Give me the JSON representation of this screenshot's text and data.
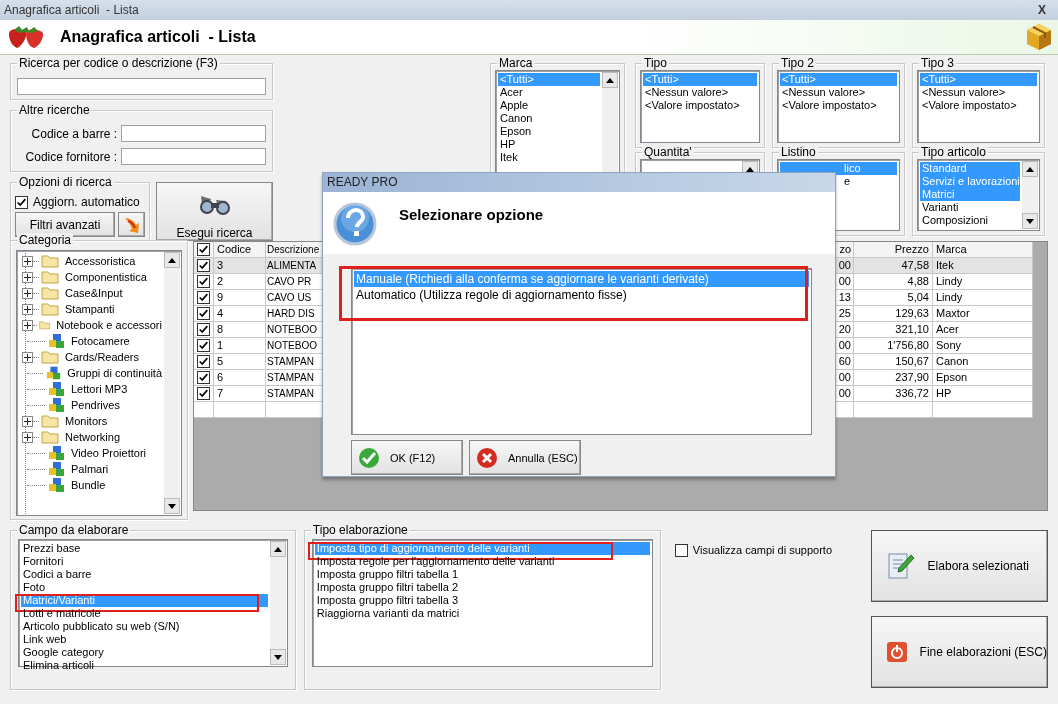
{
  "window": {
    "title": "Anagrafica articoli  - Lista",
    "close": "X"
  },
  "header": {
    "title": "Anagrafica articoli  - Lista"
  },
  "search": {
    "label": "Ricerca per codice o descrizione (F3)"
  },
  "other_searches": {
    "label": "Altre ricerche",
    "fields": [
      {
        "label": "Codice a barre :"
      },
      {
        "label": "Codice fornitore :"
      }
    ]
  },
  "search_options": {
    "label": "Opzioni di ricerca",
    "auto_update": {
      "label": "Aggiorn. automatico",
      "checked": true
    },
    "advanced_filters": "Filtri avanzati"
  },
  "run_search": "Esegui ricerca",
  "filters": [
    {
      "label": "Marca",
      "items": [
        {
          "text": "<Tutti>",
          "selected": true
        },
        {
          "text": "Acer",
          "selected": false
        },
        {
          "text": "Apple",
          "selected": false
        },
        {
          "text": "Canon",
          "selected": false
        },
        {
          "text": "Epson",
          "selected": false
        },
        {
          "text": "HP",
          "selected": false
        },
        {
          "text": "Itek",
          "selected": false
        }
      ]
    },
    {
      "label": "Tipo",
      "items": [
        {
          "text": "<Tutti>",
          "selected": true
        },
        {
          "text": "<Nessun valore>",
          "selected": false
        },
        {
          "text": "<Valore impostato>",
          "selected": false
        }
      ]
    },
    {
      "label": "Tipo 2",
      "items": [
        {
          "text": "<Tutti>",
          "selected": true
        },
        {
          "text": "<Nessun valore>",
          "selected": false
        },
        {
          "text": "<Valore impostato>",
          "selected": false
        }
      ]
    },
    {
      "label": "Tipo 3",
      "items": [
        {
          "text": "<Tutti>",
          "selected": true
        },
        {
          "text": "<Nessun valore>",
          "selected": false
        },
        {
          "text": "<Valore impostato>",
          "selected": false
        }
      ]
    },
    {
      "label": "Quantita'"
    },
    {
      "label": "Listino",
      "items": [
        {
          "text": "lico",
          "selected": true
        },
        {
          "text": "e",
          "selected": false
        }
      ]
    },
    {
      "label": "Tipo articolo",
      "items": [
        {
          "text": "Standard",
          "selected": true
        },
        {
          "text": "Servizi e lavorazioni",
          "selected": true
        },
        {
          "text": "Matrici",
          "selected": true
        },
        {
          "text": "Varianti",
          "selected": false
        },
        {
          "text": "Composizioni",
          "selected": false
        }
      ]
    }
  ],
  "category": {
    "label": "Categoria",
    "items": [
      {
        "text": "Accessoristica",
        "kind": "folder"
      },
      {
        "text": "Componentistica",
        "kind": "folder"
      },
      {
        "text": "Case&Input",
        "kind": "folder"
      },
      {
        "text": "Stampanti",
        "kind": "folder"
      },
      {
        "text": "Notebook e accessori",
        "kind": "folder"
      },
      {
        "text": "Fotocamere",
        "kind": "group"
      },
      {
        "text": "Cards/Readers",
        "kind": "folder"
      },
      {
        "text": "Gruppi di continuità",
        "kind": "group"
      },
      {
        "text": "Lettori MP3",
        "kind": "group"
      },
      {
        "text": "Pendrives",
        "kind": "group"
      },
      {
        "text": "Monitors",
        "kind": "folder"
      },
      {
        "text": "Networking",
        "kind": "folder"
      },
      {
        "text": "Video Proiettori",
        "kind": "group"
      },
      {
        "text": "Palmari",
        "kind": "group"
      },
      {
        "text": "Bundle",
        "kind": "group"
      }
    ]
  },
  "table": {
    "all_checked": true,
    "columns": [
      "Codice",
      "Descrizione",
      "zo",
      "Prezzo",
      "Marca"
    ],
    "rows": [
      {
        "checked": true,
        "selected": true,
        "cells": [
          "3",
          "ALIMENTA",
          "00",
          "47,58",
          "Itek"
        ]
      },
      {
        "checked": true,
        "selected": false,
        "cells": [
          "2",
          "CAVO PR",
          "00",
          "4,88",
          "Lindy"
        ]
      },
      {
        "checked": true,
        "selected": false,
        "cells": [
          "9",
          "CAVO US",
          "13",
          "5,04",
          "Lindy"
        ]
      },
      {
        "checked": true,
        "selected": false,
        "cells": [
          "4",
          "HARD DIS",
          "25",
          "129,63",
          "Maxtor"
        ]
      },
      {
        "checked": true,
        "selected": false,
        "cells": [
          "8",
          "NOTEBOO",
          "20",
          "321,10",
          "Acer"
        ]
      },
      {
        "checked": true,
        "selected": false,
        "cells": [
          "1",
          "NOTEBOO",
          "00",
          "1'756,80",
          "Sony"
        ]
      },
      {
        "checked": true,
        "selected": false,
        "cells": [
          "5",
          "STAMPAN",
          "60",
          "150,67",
          "Canon"
        ]
      },
      {
        "checked": true,
        "selected": false,
        "cells": [
          "6",
          "STAMPAN",
          "00",
          "237,90",
          "Epson"
        ]
      },
      {
        "checked": true,
        "selected": false,
        "cells": [
          "7",
          "STAMPAN",
          "00",
          "336,72",
          "HP"
        ]
      }
    ]
  },
  "dialog": {
    "title": "READY PRO",
    "heading": "Selezionare opzione",
    "highlighted": true,
    "options": [
      {
        "text": "Manuale (Richiedi alla conferma se aggiornare le varianti derivate)",
        "selected": true
      },
      {
        "text": "Automatico (Utilizza regole di aggiornamento fisse)",
        "selected": false
      }
    ],
    "buttons": [
      {
        "label": "OK (F12)",
        "kind": "ok"
      },
      {
        "label": "Annulla (ESC)",
        "kind": "cancel"
      }
    ]
  },
  "process_field": {
    "label": "Campo da elaborare",
    "items": [
      {
        "text": "Prezzi base",
        "selected": false,
        "highlighted": false
      },
      {
        "text": "Fornitori",
        "selected": false,
        "highlighted": false
      },
      {
        "text": "Codici a barre",
        "selected": false,
        "highlighted": false
      },
      {
        "text": "Foto",
        "selected": false,
        "highlighted": false
      },
      {
        "text": "Matrici/Varianti",
        "selected": true,
        "highlighted": true
      },
      {
        "text": "Lotti e matricole",
        "selected": false,
        "highlighted": false
      },
      {
        "text": "Articolo pubblicato su web (S/N)",
        "selected": false,
        "highlighted": false
      },
      {
        "text": "Link web",
        "selected": false,
        "highlighted": false
      },
      {
        "text": "Google category",
        "selected": false,
        "highlighted": false
      },
      {
        "text": "Elimina articoli",
        "selected": false,
        "highlighted": false
      }
    ]
  },
  "process_type": {
    "label": "Tipo elaborazione",
    "items": [
      {
        "text": "Imposta tipo di aggiornamento delle varianti",
        "selected": true,
        "highlighted": true
      },
      {
        "text": "Imposta regole per l'aggiornamento delle varianti",
        "selected": false,
        "highlighted": false
      },
      {
        "text": "Imposta gruppo filtri tabella 1",
        "selected": false,
        "highlighted": false
      },
      {
        "text": "Imposta gruppo filtri tabella 2",
        "selected": false,
        "highlighted": false
      },
      {
        "text": "Imposta gruppo filtri tabella 3",
        "selected": false,
        "highlighted": false
      },
      {
        "text": "Riaggiorna varianti da matrici",
        "selected": false,
        "highlighted": false
      }
    ]
  },
  "support_fields": {
    "label": "Visualizza campi di supporto",
    "checked": false
  },
  "actions": [
    {
      "label": "Elabora selezionati",
      "kind": "process"
    },
    {
      "label": "Fine elaborazioni (ESC)",
      "kind": "exit"
    }
  ]
}
